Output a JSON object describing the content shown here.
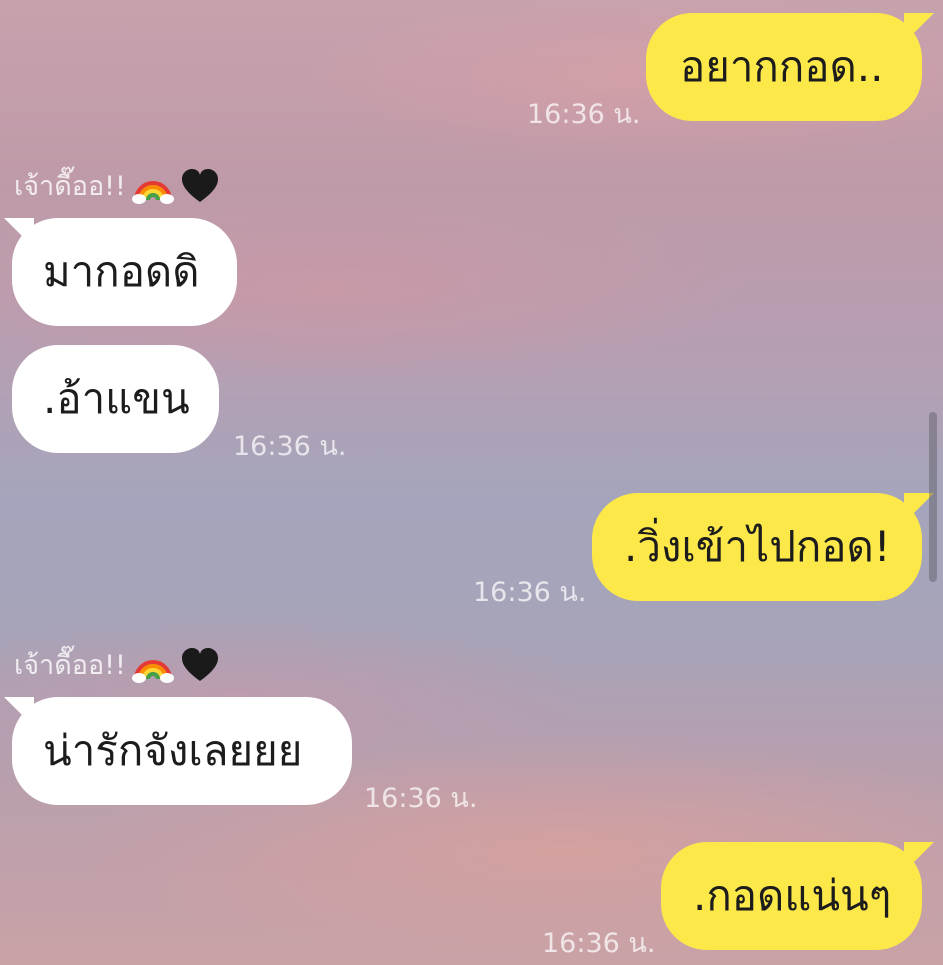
{
  "messages": [
    {
      "text": "อยากกอด..",
      "time": "16:36 น."
    },
    {
      "text": "มากอดดิ"
    },
    {
      "text": ".อ้าแขน",
      "time": "16:36 น."
    },
    {
      "text": ".วิ่งเข้าไปกอด!",
      "time": "16:36 น."
    },
    {
      "text": "น่ารักจังเลยยย",
      "time": "16:36 น."
    },
    {
      "text": ".กอดแน่นๆ",
      "time": "16:36 น."
    }
  ],
  "senders": [
    {
      "name": "เจ้าดื๊ออ!!"
    },
    {
      "name": "เจ้าดื๊ออ!!"
    }
  ],
  "icons": {
    "rainbow": "rainbow-icon",
    "heart": "black-heart-icon"
  },
  "colors": {
    "outgoing_bubble": "#fde84a",
    "incoming_bubble": "#ffffff"
  }
}
